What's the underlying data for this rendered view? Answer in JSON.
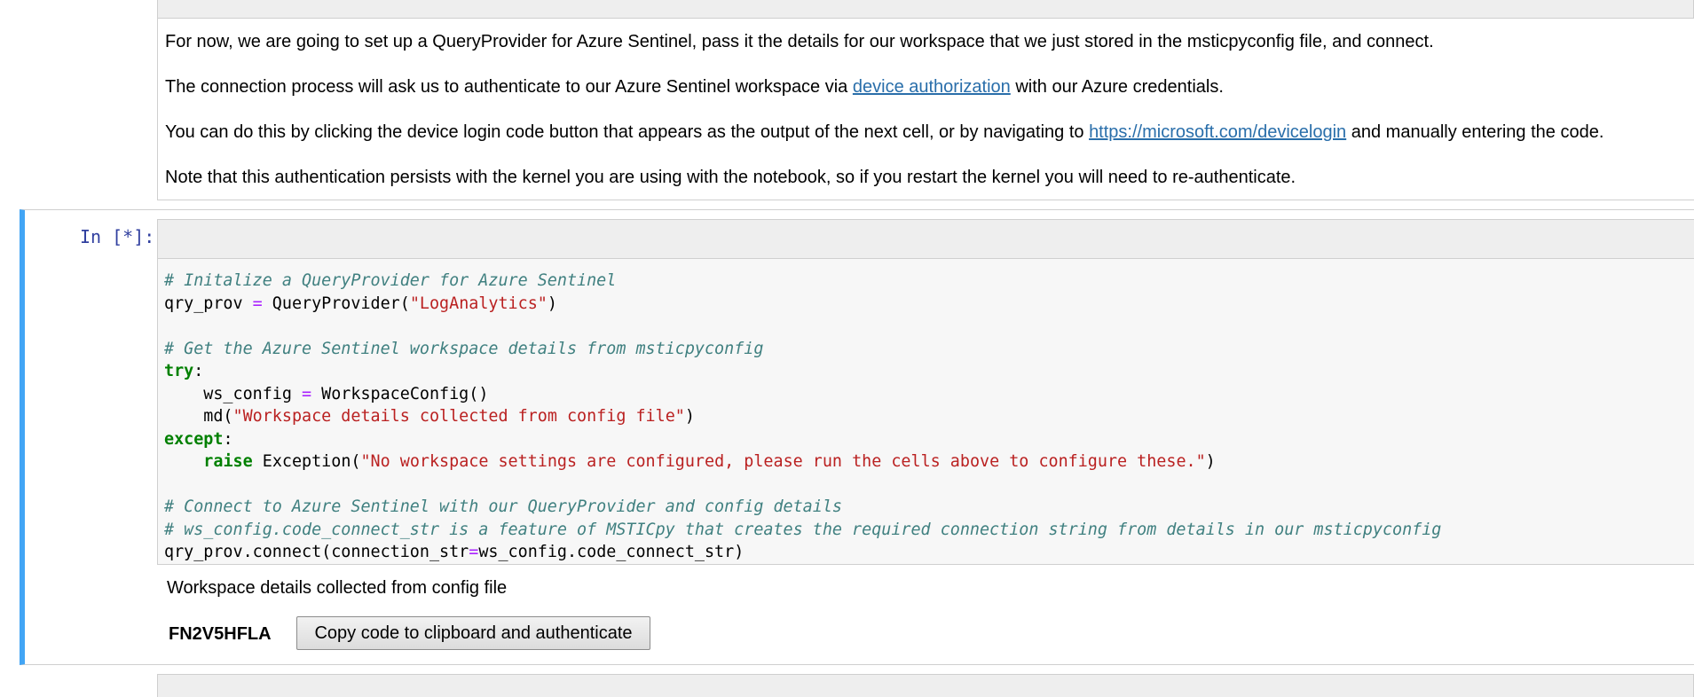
{
  "markdown": {
    "para1": "For now, we are going to set up a QueryProvider for Azure Sentinel, pass it the details for our workspace that we just stored in the msticpyconfig file, and connect.",
    "para2_before": "The connection process will ask us to authenticate to our Azure Sentinel workspace via ",
    "para2_link": "device authorization",
    "para2_after": " with our Azure credentials.",
    "para3_before": "You can do this by clicking the device login code button that appears as the output of the next cell, or by navigating to ",
    "para3_link": "https://microsoft.com/devicelogin",
    "para3_after": " and manually entering the code.",
    "para4": "Note that this authentication persists with the kernel you are using with the notebook, so if you restart the kernel you will need to re-authenticate."
  },
  "code_cell": {
    "prompt": "In [*]:",
    "code": {
      "c1": "# Initalize a QueryProvider for Azure Sentinel",
      "l2_a": "qry_prov ",
      "l2_op": "=",
      "l2_b": " QueryProvider(",
      "l2_str": "\"LogAnalytics\"",
      "l2_c": ")",
      "c4": "# Get the Azure Sentinel workspace details from msticpyconfig",
      "kw_try": "try",
      "colon1": ":",
      "l6_a": "    ws_config ",
      "l6_op": "=",
      "l6_b": " WorkspaceConfig()",
      "l7_a": "    md(",
      "l7_str": "\"Workspace details collected from config file\"",
      "l7_b": ")",
      "kw_except": "except",
      "colon2": ":",
      "l9_indent": "    ",
      "kw_raise": "raise",
      "l9_a": " Exception(",
      "l9_str": "\"No workspace settings are configured, please run the cells above to configure these.\"",
      "l9_b": ")",
      "c11": "# Connect to Azure Sentinel with our QueryProvider and config details",
      "c12": "# ws_config.code_connect_str is a feature of MSTICpy that creates the required connection string from details in our msticpyconfig",
      "l13_a": "qry_prov.connect(connection_str",
      "l13_op": "=",
      "l13_b": "ws_config.code_connect_str)"
    },
    "output": {
      "message": "Workspace details collected from config file",
      "device_code": "FN2V5HFLA",
      "button_label": "Copy code to clipboard and authenticate"
    }
  },
  "colors": {
    "selected_cell_border": "#42a5f5",
    "prompt": "#303f9f",
    "link": "#296eaa",
    "comment": "#408080",
    "string": "#ba2121",
    "keyword": "#008000",
    "operator": "#aa22ff"
  }
}
